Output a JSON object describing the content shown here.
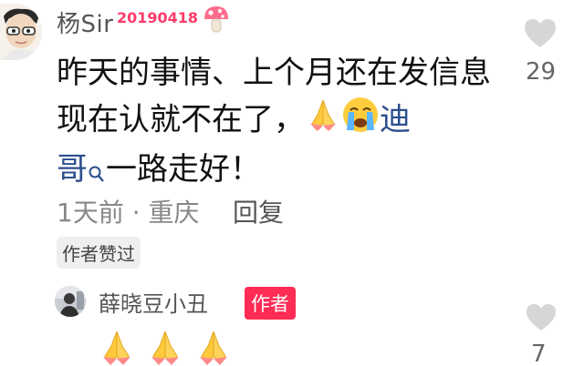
{
  "comment": {
    "username": "杨Sir",
    "user_tag": "20190418",
    "text_before_mention": "昨天的事情、上个月还在发信息现在认就不在了，",
    "mention_first": "迪",
    "mention_second": "哥",
    "text_after_mention": "一路走好！",
    "time_location": "1天前 · 重庆",
    "reply_label": "回复",
    "author_liked_badge": "作者赞过",
    "like_count": "29"
  },
  "sub_reply": {
    "username": "薛晓豆小丑",
    "author_badge": "作者",
    "like_count": "7"
  },
  "icons": {
    "like": "heart-icon",
    "emoji_pray": "folded-hands-emoji",
    "emoji_cry": "crying-face-emoji",
    "mention_search": "search-icon",
    "user_badge": "mushroom-icon"
  },
  "colors": {
    "mention": "#2b4e8d",
    "author_badge_bg": "#ff2c55",
    "heart": "#d6d6d6"
  }
}
